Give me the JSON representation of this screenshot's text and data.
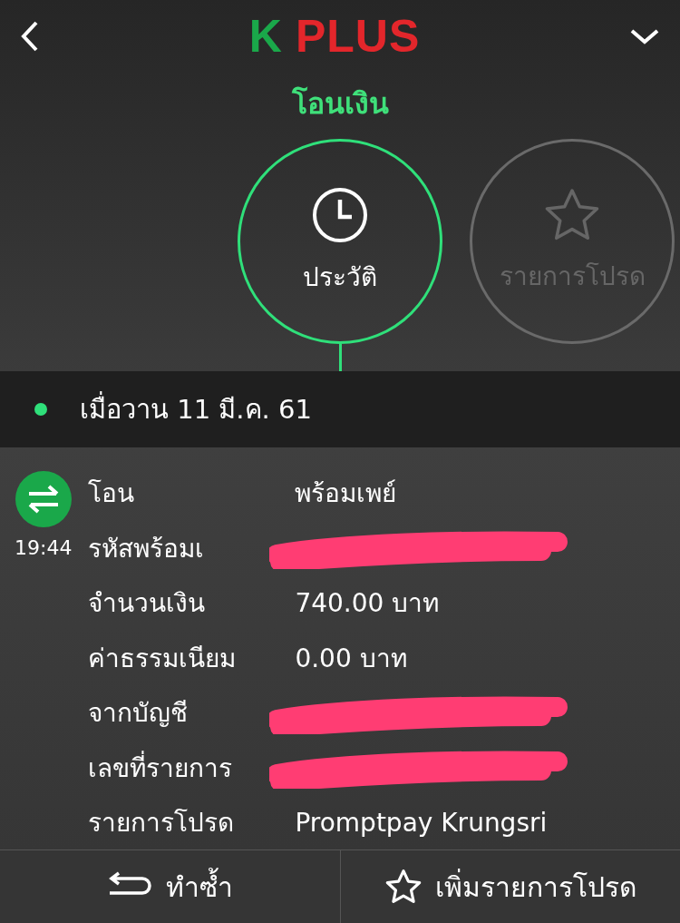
{
  "header": {
    "logo_k": "K",
    "logo_rest": "PLUS"
  },
  "title": "โอนเงิน",
  "tabs": [
    {
      "label": "ประวัติ",
      "kind": "history",
      "selected": true
    },
    {
      "label": "รายการโปรด",
      "kind": "favorite",
      "selected": false
    }
  ],
  "date_bar": {
    "label": "เมื่อวาน 11 มี.ค. 61"
  },
  "transaction": {
    "time": "19:44",
    "rows": [
      {
        "label": "โอน",
        "value": "พร้อมเพย์",
        "redacted": false
      },
      {
        "label": "รหัสพร้อมเ",
        "redacted": true
      },
      {
        "label": "จำนวนเงิน",
        "value": "740.00 บาท",
        "redacted": false
      },
      {
        "label": "ค่าธรรมเนียม",
        "value": "0.00 บาท",
        "redacted": false
      },
      {
        "label": "จากบัญชี",
        "redacted": true
      },
      {
        "label": "เลขที่รายการ",
        "redacted": true
      },
      {
        "label": "รายการโปรด",
        "value": "Promptpay Krungsri",
        "redacted": false
      }
    ]
  },
  "actions": [
    {
      "label": "ทำซ้ำ",
      "kind": "repeat"
    },
    {
      "label": "เพิ่มรายการโปรด",
      "kind": "favorite"
    }
  ]
}
